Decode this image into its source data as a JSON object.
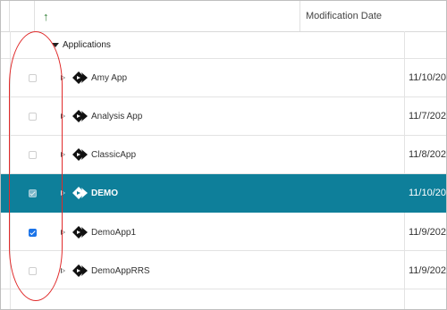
{
  "header": {
    "sort_indicator": "↑",
    "date_column_label": "Modification Date"
  },
  "group": {
    "label": "Applications"
  },
  "rows": [
    {
      "name": "Amy App",
      "date": "11/10/20",
      "checked": false,
      "selected": false
    },
    {
      "name": "Analysis App",
      "date": "11/7/202",
      "checked": false,
      "selected": false
    },
    {
      "name": "ClassicApp",
      "date": "11/8/202",
      "checked": false,
      "selected": false
    },
    {
      "name": "DEMO",
      "date": "11/10/20",
      "checked": true,
      "selected": true
    },
    {
      "name": "DemoApp1",
      "date": "11/9/202",
      "checked": true,
      "selected": false
    },
    {
      "name": "DemoAppRRS",
      "date": "11/9/202",
      "checked": false,
      "selected": false
    }
  ],
  "icons": {
    "expander": "expand-arrow-icon",
    "app": "app-diamond-icon",
    "group_caret": "collapse-caret-icon"
  },
  "colors": {
    "selected_row": "#0e7f9a",
    "checkbox_checked": "#1a73e8",
    "annotation": "#e02a2a",
    "sort_arrow": "#2e7d32"
  }
}
